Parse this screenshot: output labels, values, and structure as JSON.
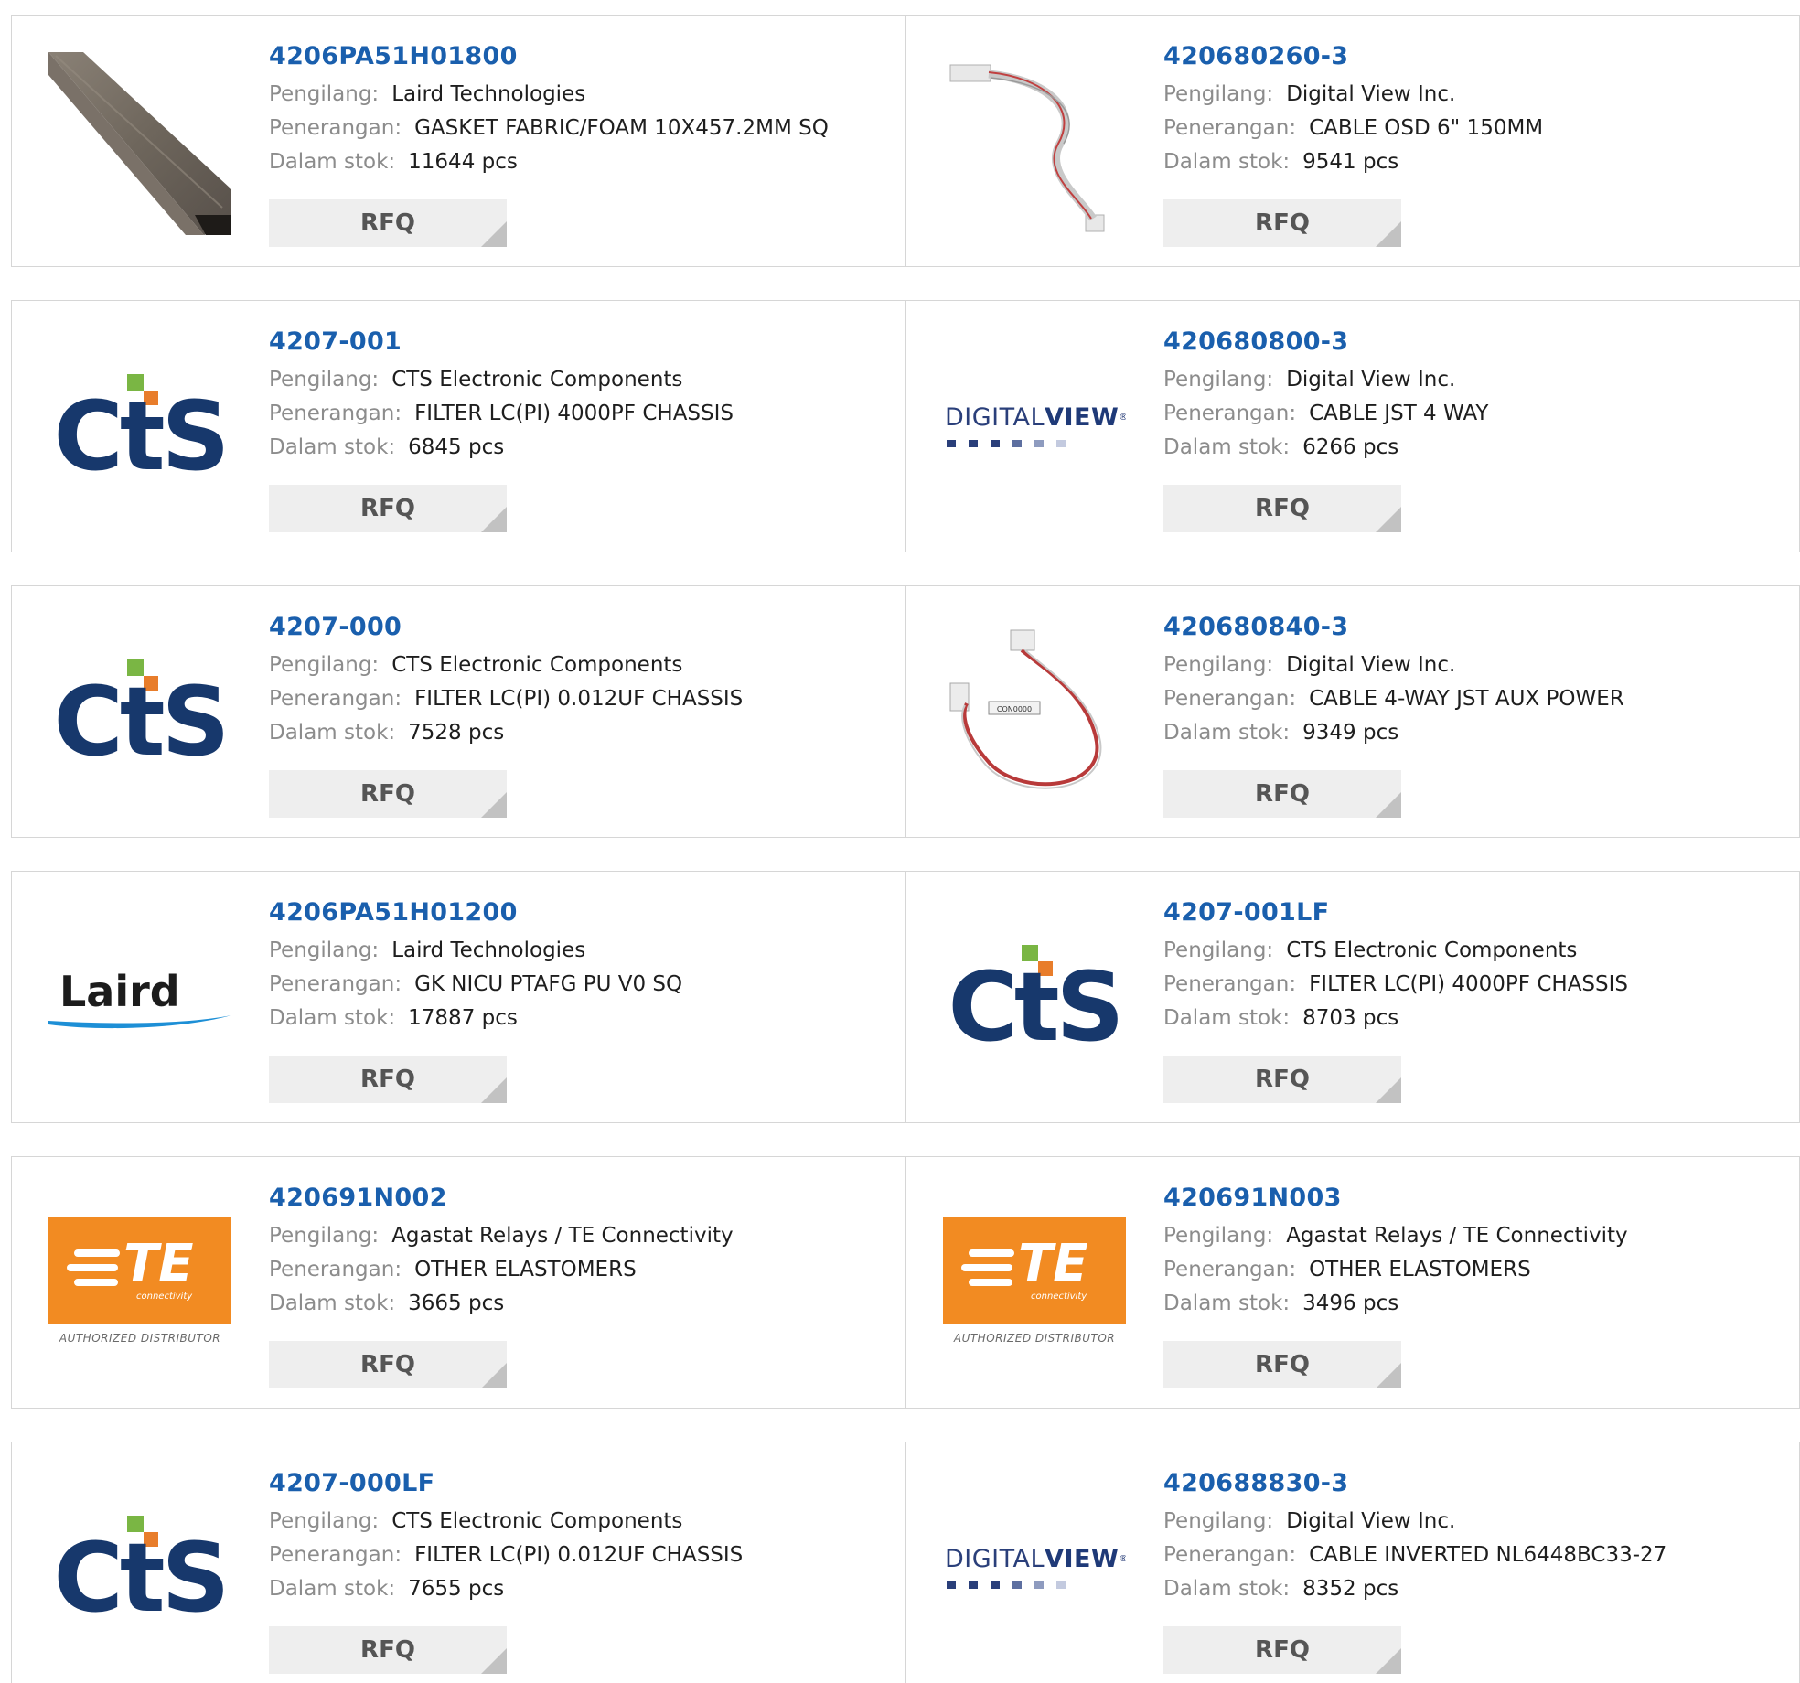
{
  "labels": {
    "manufacturer": "Pengilang:",
    "description": "Penerangan:",
    "stock": "Dalam stok:",
    "rfq": "RFQ"
  },
  "products": [
    {
      "part": "4206PA51H01800",
      "manufacturer": "Laird Technologies",
      "description": "GASKET FABRIC/FOAM 10X457.2MM SQ",
      "stock": "11644 pcs",
      "image": "gasket-photo"
    },
    {
      "part": "420680260-3",
      "manufacturer": "Digital View Inc.",
      "description": "CABLE OSD 6\" 150MM",
      "stock": "9541 pcs",
      "image": "cable-photo"
    },
    {
      "part": "4207-001",
      "manufacturer": "CTS Electronic Components",
      "description": "FILTER LC(PI) 4000PF CHASSIS",
      "stock": "6845 pcs",
      "image": "cts-logo"
    },
    {
      "part": "420680800-3",
      "manufacturer": "Digital View Inc.",
      "description": "CABLE JST 4 WAY",
      "stock": "6266 pcs",
      "image": "digitalview-logo"
    },
    {
      "part": "4207-000",
      "manufacturer": "CTS Electronic Components",
      "description": "FILTER LC(PI) 0.012UF CHASSIS",
      "stock": "7528 pcs",
      "image": "cts-logo"
    },
    {
      "part": "420680840-3",
      "manufacturer": "Digital View Inc.",
      "description": "CABLE 4-WAY JST AUX POWER",
      "stock": "9349 pcs",
      "image": "cable-loop-photo"
    },
    {
      "part": "4206PA51H01200",
      "manufacturer": "Laird Technologies",
      "description": "GK NICU PTAFG PU V0 SQ",
      "stock": "17887 pcs",
      "image": "laird-logo"
    },
    {
      "part": "4207-001LF",
      "manufacturer": "CTS Electronic Components",
      "description": "FILTER LC(PI) 4000PF CHASSIS",
      "stock": "8703 pcs",
      "image": "cts-logo"
    },
    {
      "part": "420691N002",
      "manufacturer": "Agastat Relays / TE Connectivity",
      "description": "OTHER ELASTOMERS",
      "stock": "3665 pcs",
      "image": "te-logo"
    },
    {
      "part": "420691N003",
      "manufacturer": "Agastat Relays / TE Connectivity",
      "description": "OTHER ELASTOMERS",
      "stock": "3496 pcs",
      "image": "te-logo"
    },
    {
      "part": "4207-000LF",
      "manufacturer": "CTS Electronic Components",
      "description": "FILTER LC(PI) 0.012UF CHASSIS",
      "stock": "7655 pcs",
      "image": "cts-logo"
    },
    {
      "part": "420688830-3",
      "manufacturer": "Digital View Inc.",
      "description": "CABLE INVERTED NL6448BC33-27",
      "stock": "8352 pcs",
      "image": "digitalview-logo"
    }
  ],
  "logos": {
    "cts": "CtS",
    "digitalview_a": "DIGITAL",
    "digitalview_b": "VIEW",
    "digitalview_reg": "®",
    "laird": "Laird",
    "te": "TE",
    "te_sub": "connectivity",
    "te_authorized": "AUTHORIZED DISTRIBUTOR",
    "cable_tag": "CON0000"
  },
  "colors": {
    "link": "#1a5fad",
    "label": "#8c8c8c",
    "button_bg": "#eeeeee",
    "border": "#d6d6d6",
    "te_orange": "#f28b22",
    "cts_blue": "#17386c"
  }
}
